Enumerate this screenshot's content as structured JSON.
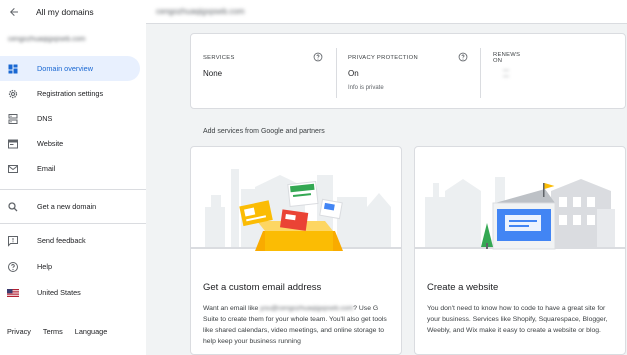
{
  "header": {
    "back_label": "All my domains",
    "domain_title": "cengozhuaqigxpseb.com"
  },
  "sidebar": {
    "account": "cengozhuaqigxpseb.com",
    "items": [
      {
        "label": "Domain overview",
        "icon": "dashboard-icon",
        "active": true
      },
      {
        "label": "Registration settings",
        "icon": "gear-icon"
      },
      {
        "label": "DNS",
        "icon": "dns-icon"
      },
      {
        "label": "Website",
        "icon": "website-icon"
      },
      {
        "label": "Email",
        "icon": "email-icon"
      }
    ],
    "get_new_domain": "Get a new domain",
    "send_feedback": "Send feedback",
    "help": "Help",
    "country": "United States",
    "footer": {
      "privacy": "Privacy",
      "terms": "Terms",
      "language": "Language"
    }
  },
  "summary": {
    "services": {
      "heading": "SERVICES",
      "value": "None"
    },
    "privacy": {
      "heading": "PRIVACY PROTECTION",
      "value": "On",
      "sub": "Info is private"
    },
    "renews": {
      "heading": "RENEWS ON",
      "value": "— —"
    }
  },
  "section_title": "Add services from Google and partners",
  "cards": {
    "email": {
      "title": "Get a custom email address",
      "desc_pre": "Want an email like ",
      "desc_blur": "you@cengozhuaqigxpseb.com",
      "desc_post": "? Use G Suite to create them for your whole team. You'll also get tools like shared calendars, video meetings, and online storage to help keep your business running"
    },
    "website": {
      "title": "Create a website",
      "desc": "You don't need to know how to code to have a great site for your business. Services like Shopify, Squarespace, Blogger, Weebly, and Wix make it easy to create a website or blog."
    }
  },
  "colors": {
    "accent": "#1967d2",
    "active_bg": "#e8f0fe",
    "yellow": "#fbbc04",
    "green": "#34a853",
    "red": "#ea4335",
    "blue": "#4285f4"
  }
}
